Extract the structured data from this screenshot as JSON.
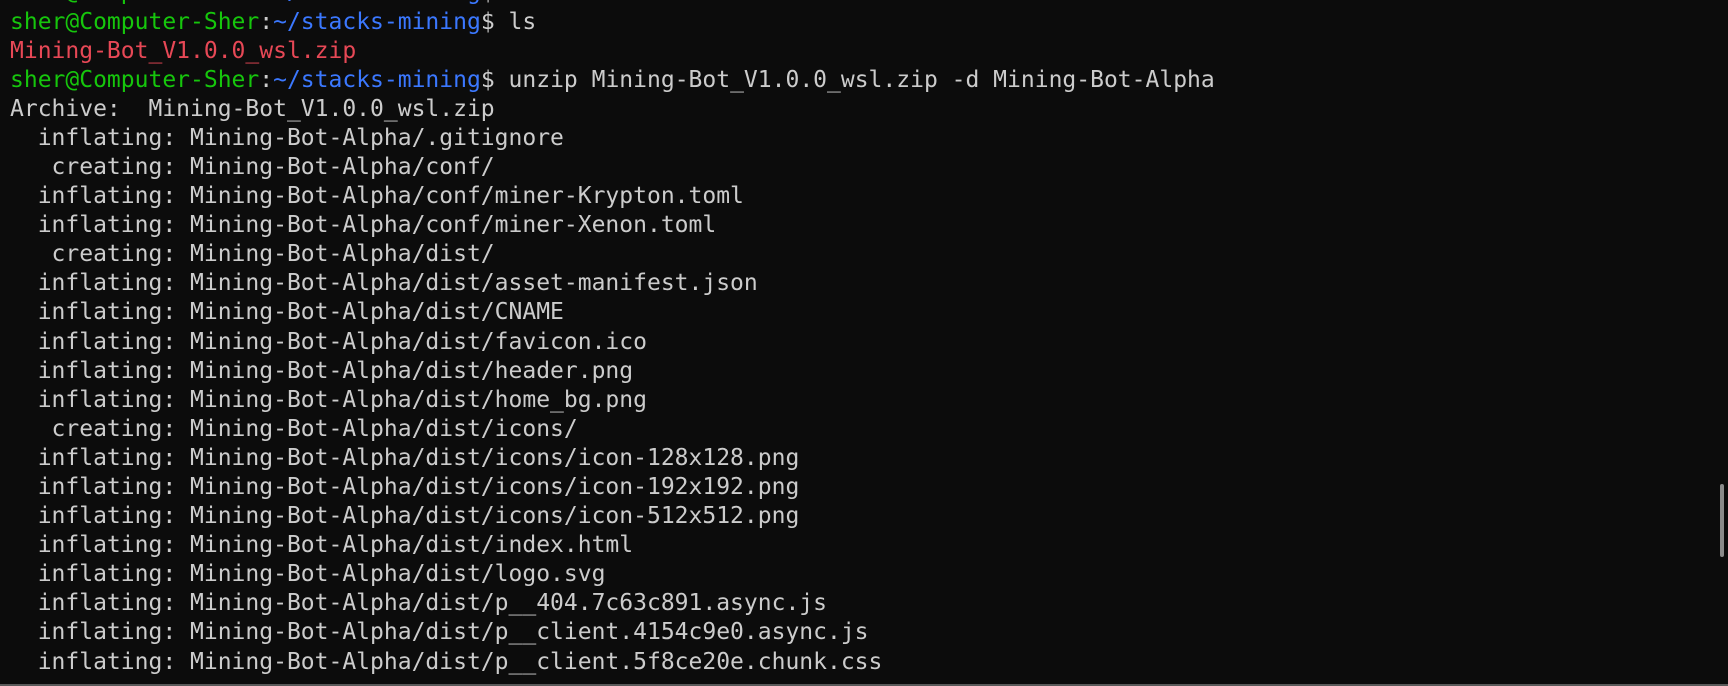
{
  "prompt": {
    "user_host": "sher@Computer-Sher",
    "sep": ":",
    "path": "~/stacks-mining",
    "symbol": "$ "
  },
  "commands": {
    "ls": "ls",
    "unzip": "unzip Mining-Bot_V1.0.0_wsl.zip -d Mining-Bot-Alpha"
  },
  "ls_output": "Mining-Bot_V1.0.0_wsl.zip",
  "archive_line": "Archive:  Mining-Bot_V1.0.0_wsl.zip",
  "output_lines": [
    "  inflating: Mining-Bot-Alpha/.gitignore",
    "   creating: Mining-Bot-Alpha/conf/",
    "  inflating: Mining-Bot-Alpha/conf/miner-Krypton.toml",
    "  inflating: Mining-Bot-Alpha/conf/miner-Xenon.toml",
    "   creating: Mining-Bot-Alpha/dist/",
    "  inflating: Mining-Bot-Alpha/dist/asset-manifest.json",
    "  inflating: Mining-Bot-Alpha/dist/CNAME",
    "  inflating: Mining-Bot-Alpha/dist/favicon.ico",
    "  inflating: Mining-Bot-Alpha/dist/header.png",
    "  inflating: Mining-Bot-Alpha/dist/home_bg.png",
    "   creating: Mining-Bot-Alpha/dist/icons/",
    "  inflating: Mining-Bot-Alpha/dist/icons/icon-128x128.png",
    "  inflating: Mining-Bot-Alpha/dist/icons/icon-192x192.png",
    "  inflating: Mining-Bot-Alpha/dist/icons/icon-512x512.png",
    "  inflating: Mining-Bot-Alpha/dist/index.html",
    "  inflating: Mining-Bot-Alpha/dist/logo.svg",
    "  inflating: Mining-Bot-Alpha/dist/p__404.7c63c891.async.js",
    "  inflating: Mining-Bot-Alpha/dist/p__client.4154c9e0.async.js",
    "  inflating: Mining-Bot-Alpha/dist/p__client.5f8ce20e.chunk.css"
  ]
}
